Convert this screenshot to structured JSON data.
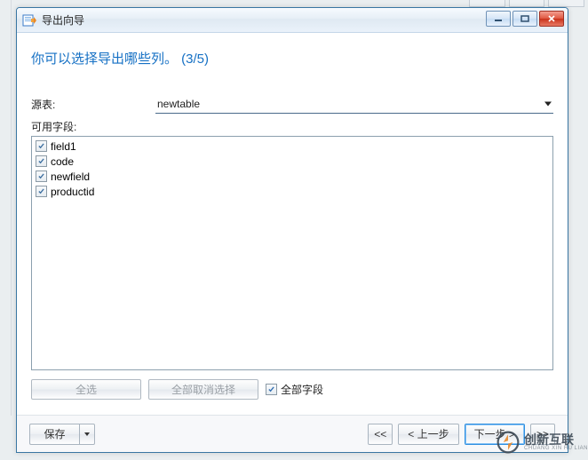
{
  "window": {
    "title": "导出向导",
    "heading": "你可以选择导出哪些列。 (3/5)"
  },
  "source": {
    "label": "源表:",
    "value": "newtable"
  },
  "fields": {
    "label": "可用字段:",
    "items": [
      {
        "name": "field1",
        "checked": true
      },
      {
        "name": "code",
        "checked": true
      },
      {
        "name": "newfield",
        "checked": true
      },
      {
        "name": "productid",
        "checked": true
      }
    ]
  },
  "buttons": {
    "select_all": "全选",
    "deselect_all": "全部取消选择",
    "all_fields_label": "全部字段",
    "all_fields_checked": true
  },
  "footer": {
    "save": "保存",
    "first": "<<",
    "prev": "< 上一步",
    "next": "下一步 >",
    "last": ">>"
  },
  "watermark": {
    "text": "创新互联",
    "sub": "CHUANG XIN HU LIAN"
  }
}
